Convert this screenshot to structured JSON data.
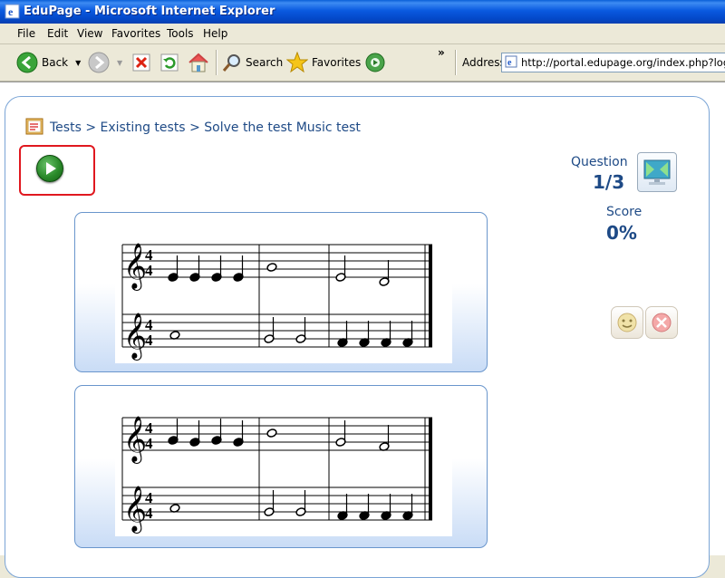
{
  "window": {
    "title": "EduPage - Microsoft Internet Explorer"
  },
  "menu": [
    "File",
    "Edit",
    "View",
    "Favorites",
    "Tools",
    "Help"
  ],
  "toolbar": {
    "back": "Back",
    "search": "Search",
    "favorites": "Favorites",
    "chevron": "»",
    "address_label": "Address",
    "address_value": "http://portal.edupage.org/index.php?login&PS"
  },
  "breadcrumb": {
    "tests": "Tests",
    "sep1": ">",
    "existing": "Existing tests",
    "sep2": ">",
    "current": "Solve the test Music test"
  },
  "question": {
    "label": "Question",
    "value": "1/3"
  },
  "score": {
    "label": "Score",
    "value": "0%"
  },
  "colors": {
    "title_blue": "#0a5ae0",
    "link_blue": "#1e4a86",
    "highlight_red": "#e0181f",
    "play_green": "#2a8a2a",
    "card_border": "#6a96cc"
  },
  "icons": [
    "ie-icon",
    "back-icon",
    "forward-icon",
    "stop-icon",
    "refresh-icon",
    "home-icon",
    "search-icon",
    "favorites-icon",
    "media-icon",
    "page-icon",
    "test-book-icon",
    "play-icon",
    "monitor-icon",
    "smile-icon",
    "close-icon"
  ]
}
